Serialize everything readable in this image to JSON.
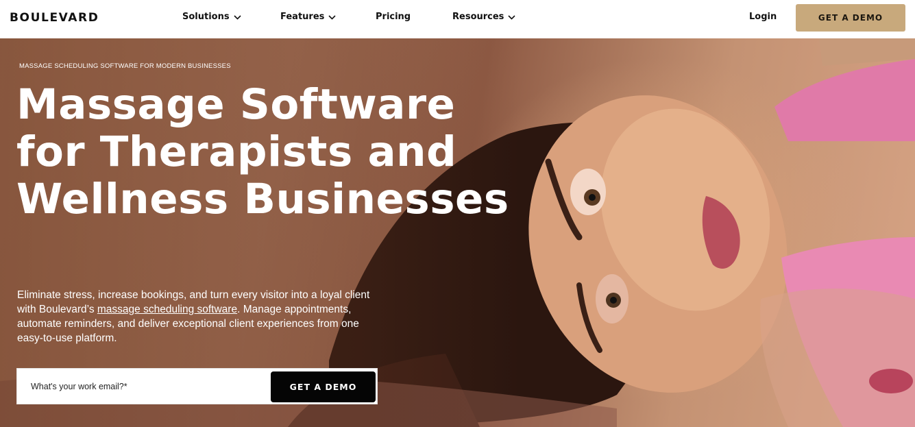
{
  "brand": {
    "logo_text": "BOULEVARD"
  },
  "nav": {
    "items": [
      {
        "label": "Solutions",
        "has_dropdown": true
      },
      {
        "label": "Features",
        "has_dropdown": true
      },
      {
        "label": "Pricing",
        "has_dropdown": false
      },
      {
        "label": "Resources",
        "has_dropdown": true
      }
    ],
    "login_label": "Login",
    "cta_label": "GET A DEMO"
  },
  "hero": {
    "eyebrow": "MASSAGE SCHEDULING SOFTWARE FOR MODERN BUSINESSES",
    "headline": "Massage Software for Therapists and Wellness Businesses",
    "lede_before_link": "Eliminate stress, increase bookings, and turn every visitor into a loyal client with Boulevard’s ",
    "lede_link": "massage scheduling software",
    "lede_after_link": ". Manage appointments, automate reminders, and deliver exceptional client experiences from one easy-to-use platform.",
    "email_placeholder": "What's your work email?*",
    "cta_label": "GET A DEMO"
  },
  "colors": {
    "accent": "#c8a97c",
    "cta_dark": "#050505",
    "hero_tone": "#a8745a",
    "shirt_pink": "#e07aa8"
  },
  "icons": [
    "chevron-down-icon"
  ]
}
